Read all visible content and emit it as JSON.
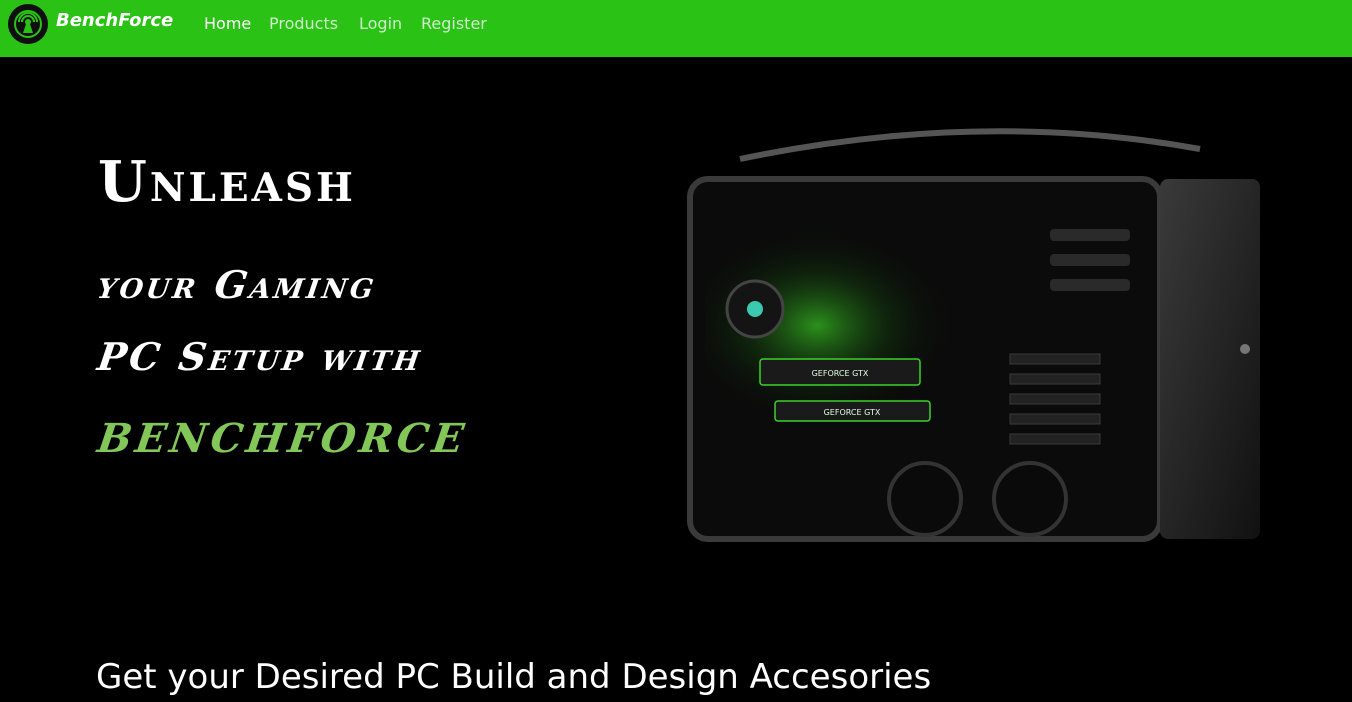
{
  "nav": {
    "brand": "BenchForce",
    "links": [
      {
        "label": "Home",
        "active": true
      },
      {
        "label": "Products",
        "active": false
      },
      {
        "label": "Login",
        "active": false
      },
      {
        "label": "Register",
        "active": false
      }
    ]
  },
  "hero": {
    "line1": "Unleash",
    "line2": "your Gaming",
    "line3": "PC Setup with",
    "line4": "BENCHFORCE",
    "gpu_label_1": "GEFORCE GTX",
    "gpu_label_2": "GEFORCE GTX"
  },
  "section": {
    "heading": "Get your Desired PC Build and Design Accesories"
  },
  "colors": {
    "nav_bg": "#2ac214",
    "accent_green": "#82c758",
    "background": "#000000"
  }
}
